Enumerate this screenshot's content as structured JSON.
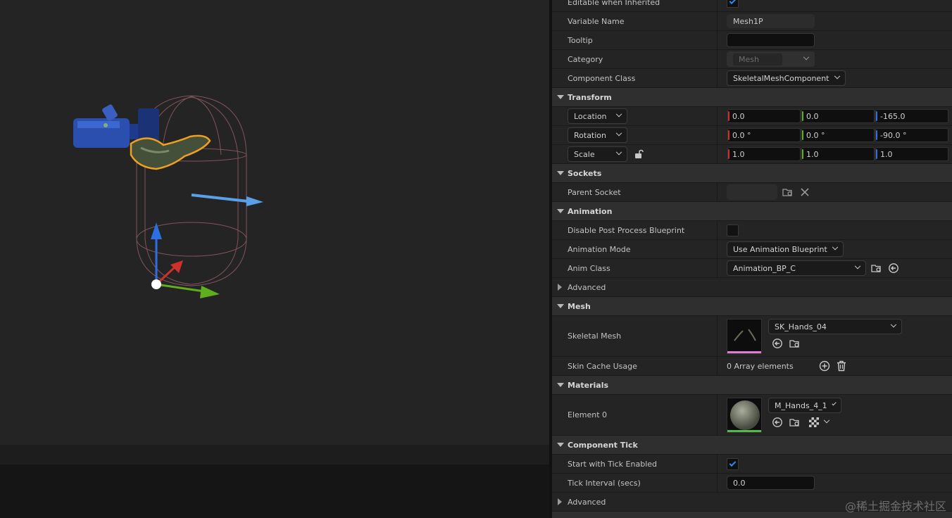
{
  "viewport": {
    "colors": {
      "background": "#242424",
      "x_axis": "#d0302a",
      "y_axis": "#5fae1c",
      "z_axis": "#2d6ee0",
      "capsule": "#8a5a62",
      "arrow": "#5aa0e8",
      "selection": "#f0a020"
    }
  },
  "details": {
    "rows": [
      {
        "type": "prop",
        "label": "Editable when Inherited",
        "control": "checkbox",
        "checked": true
      },
      {
        "type": "prop",
        "label": "Variable Name",
        "control": "textbox",
        "value": "Mesh1P"
      },
      {
        "type": "prop",
        "label": "Tooltip",
        "control": "textbox",
        "value": ""
      },
      {
        "type": "prop",
        "label": "Category",
        "control": "combo-disabled",
        "value": "Mesh"
      },
      {
        "type": "prop",
        "label": "Component Class",
        "control": "combo",
        "value": "SkeletalMeshComponent"
      }
    ],
    "transform": {
      "category": "Transform",
      "location": {
        "label": "Location",
        "x": "0.0",
        "y": "0.0",
        "z": "-165.0"
      },
      "rotation": {
        "label": "Rotation",
        "x": "0.0 °",
        "y": "0.0 °",
        "z": "-90.0 °"
      },
      "scale": {
        "label": "Scale",
        "x": "1.0",
        "y": "1.0",
        "z": "1.0"
      }
    },
    "sockets": {
      "category": "Sockets",
      "parent_socket_label": "Parent Socket"
    },
    "animation": {
      "category": "Animation",
      "disable_pp_label": "Disable Post Process Blueprint",
      "mode_label": "Animation Mode",
      "mode_value": "Use Animation Blueprint",
      "anim_class_label": "Anim Class",
      "anim_class_value": "Animation_BP_C",
      "advanced_label": "Advanced"
    },
    "mesh": {
      "category": "Mesh",
      "skeletal_mesh_label": "Skeletal Mesh",
      "skeletal_mesh_value": "SK_Hands_04",
      "skin_cache_label": "Skin Cache Usage",
      "skin_cache_value": "0 Array elements"
    },
    "materials": {
      "category": "Materials",
      "element_label": "Element 0",
      "element_value": "M_Hands_4_1"
    },
    "tick": {
      "category": "Component Tick",
      "start_label": "Start with Tick Enabled",
      "interval_label": "Tick Interval (secs)",
      "interval_value": "0.0",
      "advanced_label": "Advanced"
    }
  },
  "watermark": "@稀土掘金技术社区"
}
